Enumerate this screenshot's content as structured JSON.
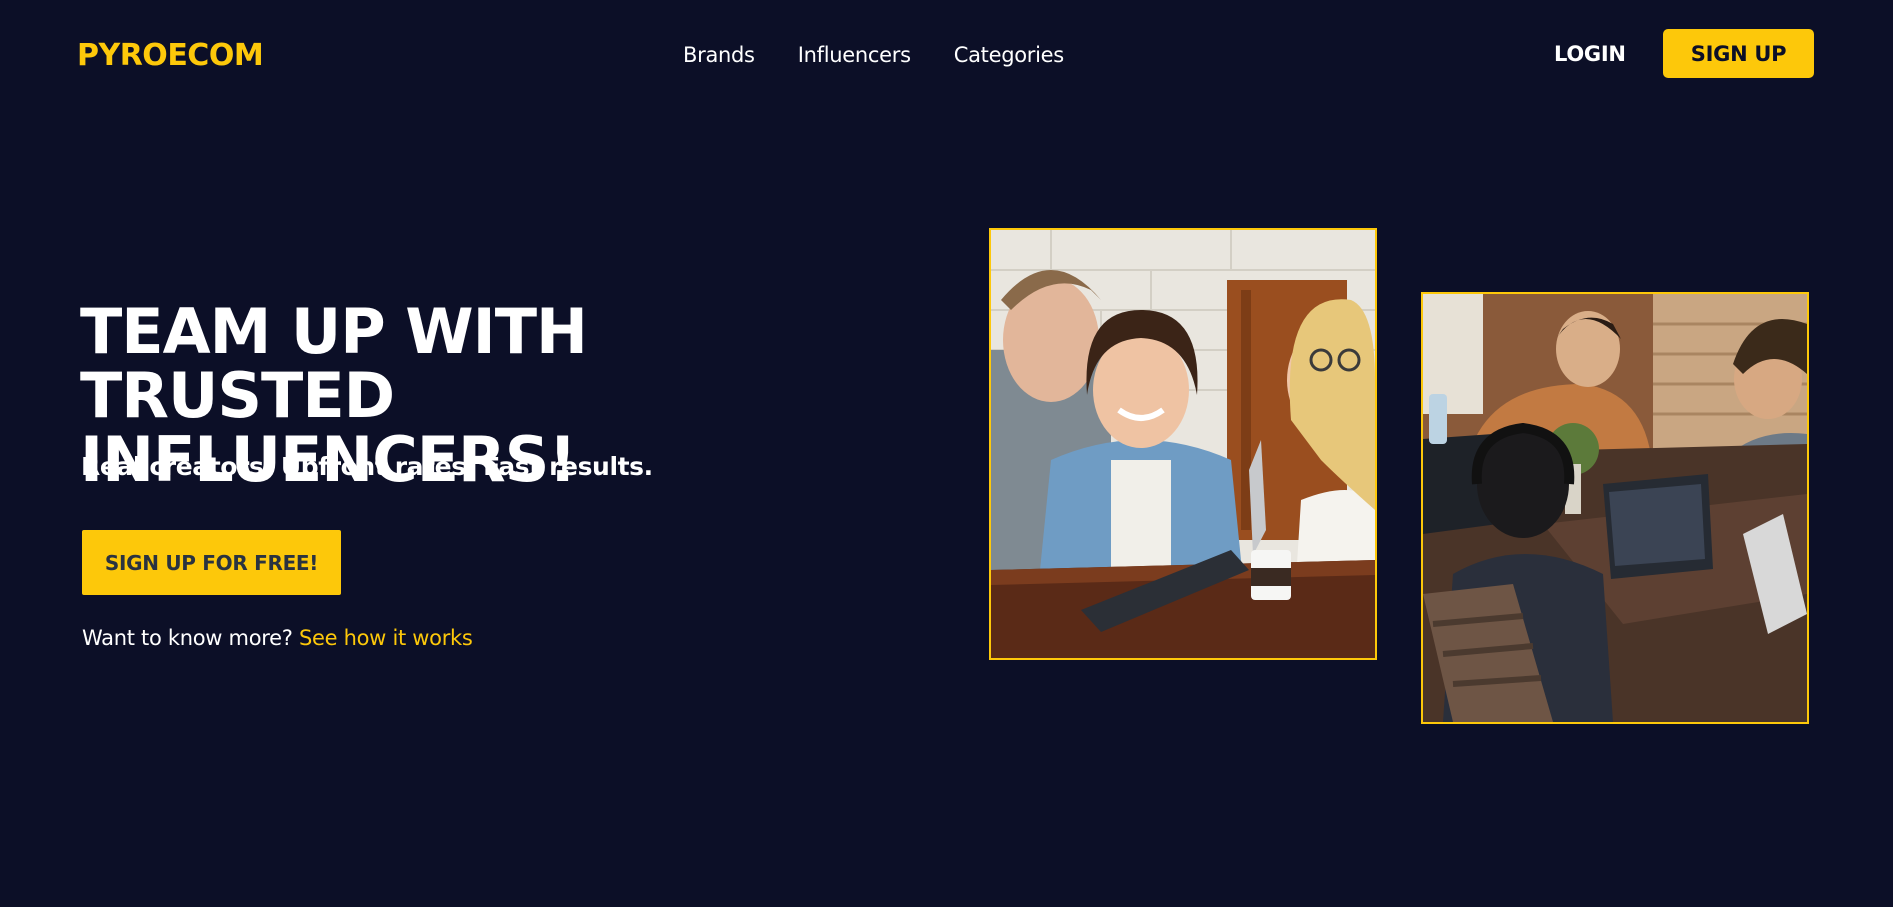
{
  "brand": {
    "name": "PYROECOM"
  },
  "nav": {
    "items": [
      "Brands",
      "Influencers",
      "Categories"
    ]
  },
  "auth": {
    "login_label": "LOGIN",
    "signup_label": "SIGN UP"
  },
  "hero": {
    "title_line1": "TEAM UP WITH TRUSTED",
    "title_line2": "INFLUENCERS!",
    "subtitle": "Real creators. Upfront rates. Fast results.",
    "cta_label": "SIGN UP FOR FREE!",
    "more_text": "Want to know more?",
    "more_link": "See how it works"
  },
  "images": [
    {
      "icon": "photo-people-cafe-tablet"
    },
    {
      "icon": "photo-team-laptops"
    }
  ],
  "colors": {
    "background": "#0c0f27",
    "accent": "#fdc80a",
    "text": "#ffffff"
  }
}
